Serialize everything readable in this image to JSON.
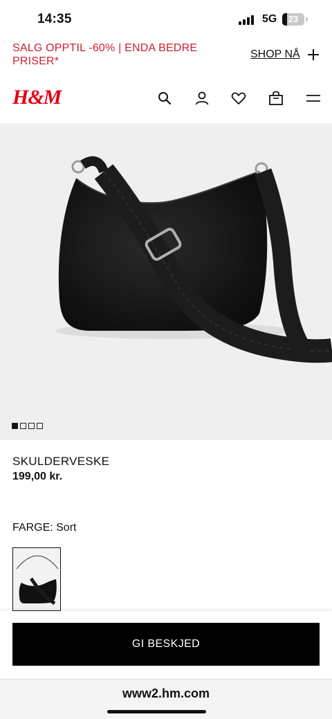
{
  "status_bar": {
    "time": "14:35",
    "network": "5G",
    "battery": "23",
    "battery_level_percent": 23
  },
  "promo": {
    "text": "SALG OPPTIL -60% | ENDA BEDRE PRISER*",
    "link_label": "SHOP NÅ",
    "accent_color": "#cc1f2c"
  },
  "header": {
    "logo": "H&M",
    "logo_color": "#e3000f",
    "icons": [
      "search-icon",
      "account-icon",
      "favorites-heart-icon",
      "shopping-bag-icon",
      "menu-icon"
    ]
  },
  "product": {
    "image_name": "black-shoulder-bag",
    "carousel": {
      "total": 4,
      "active": 1
    },
    "name": "SKULDERVESKE",
    "price": "199,00 kr.",
    "color_label": "FARGE: Sort"
  },
  "cta": {
    "label": "GI BESKJED"
  },
  "browser": {
    "url": "www2.hm.com"
  }
}
